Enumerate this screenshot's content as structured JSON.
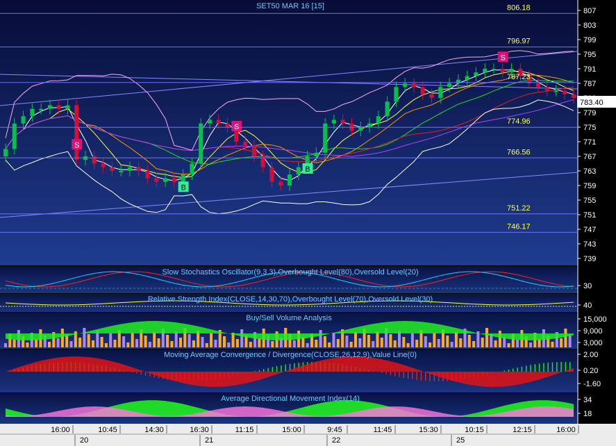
{
  "colors": {
    "bg_top": "#0c1446",
    "bg_bottom": "#1e3a8c",
    "candle_up": "#00c24a",
    "candle_down": "#d0103a",
    "level_line": "#6a6af0",
    "level_label": "#ffff66",
    "axis_text": "#ffffff",
    "title_text": "#66ccff",
    "buy_marker": "#33ee99",
    "sell_marker": "#dd1177",
    "green_fill": "#22ee22",
    "red_fill": "#ee1111",
    "pink_fill": "#ff77dd",
    "volume_up": "#ffaa22",
    "volume_down": "#aa88ee"
  },
  "chart_data": [
    {
      "type": "candlestick",
      "title": "SET50 MAR 16  [15]",
      "last_price": "783.40",
      "ylim": [
        736,
        810
      ],
      "y_ticks": [
        "807",
        "803",
        "799",
        "795",
        "791",
        "787",
        "783",
        "779",
        "775",
        "771",
        "767",
        "763",
        "759",
        "755",
        "751",
        "747",
        "743",
        "739"
      ],
      "levels": [
        "806.18",
        "796.97",
        "787.23",
        "774.96",
        "766.56",
        "751.22",
        "746.17"
      ],
      "signals": [
        {
          "label": "S",
          "kind": "sell",
          "bar": 8
        },
        {
          "label": "B",
          "kind": "buy",
          "bar": 20
        },
        {
          "label": "S",
          "kind": "sell",
          "bar": 26
        },
        {
          "label": "B",
          "kind": "buy",
          "bar": 34
        },
        {
          "label": "S",
          "kind": "sell",
          "bar": 56
        }
      ],
      "closes": [
        769,
        776,
        778,
        780,
        780,
        781,
        780,
        781,
        766,
        767,
        765,
        764,
        763,
        763,
        764,
        763,
        761,
        760,
        761,
        760,
        762,
        765,
        776,
        777,
        776,
        775,
        771,
        770,
        767,
        764,
        760,
        759,
        762,
        764,
        767,
        768,
        776,
        777,
        776,
        774,
        775,
        776,
        778,
        782,
        786,
        787,
        786,
        784,
        783,
        786,
        787,
        788,
        789,
        790,
        791,
        791,
        790,
        791,
        789,
        787,
        786,
        785,
        785,
        784,
        783
      ]
    },
    {
      "type": "line",
      "title": "Slow Stochastics Oscillator(9,3,3),Overbought Level(80),Oversold Level(20)",
      "y_ticks": [
        "30"
      ]
    },
    {
      "type": "line",
      "title": "Relative Strength Index(CLOSE,14,30,70),Overbought Level(70),Oversold Level(30)",
      "y_ticks": [
        "40"
      ]
    },
    {
      "type": "bar",
      "title": "Buy/Sell Volume Analysis",
      "y_ticks": [
        "15,000",
        "9,000",
        "3,000"
      ]
    },
    {
      "type": "area",
      "title": "Moving Average Convergence / Divergence(CLOSE,26,12,9),Value Line(0)",
      "y_ticks": [
        "2.00",
        "0.20",
        "-1.60"
      ]
    },
    {
      "type": "area",
      "title": "Average Directional Movement Index(14)",
      "y_ticks": [
        "34",
        "18"
      ]
    }
  ],
  "x_axis": {
    "times": [
      "16:00",
      "10:45",
      "14:30",
      "16:30",
      "11:15",
      "15:00",
      "9:45",
      "11:45",
      "15:30",
      "10:15",
      "12:15",
      "16:00"
    ],
    "dates": [
      "20",
      "21",
      "22",
      "25"
    ]
  }
}
